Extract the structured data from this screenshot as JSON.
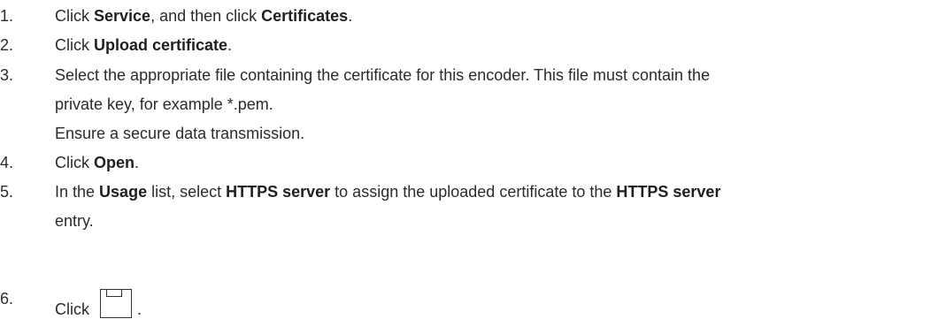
{
  "steps": [
    {
      "number": "1.",
      "lines": [
        [
          {
            "t": "Click ",
            "b": false
          },
          {
            "t": "Service",
            "b": true
          },
          {
            "t": ", and then click ",
            "b": false
          },
          {
            "t": "Certificates",
            "b": true
          },
          {
            "t": ".",
            "b": false
          }
        ]
      ]
    },
    {
      "number": "2.",
      "lines": [
        [
          {
            "t": "Click ",
            "b": false
          },
          {
            "t": "Upload certificate",
            "b": true
          },
          {
            "t": ".",
            "b": false
          }
        ]
      ]
    },
    {
      "number": "3.",
      "lines": [
        [
          {
            "t": "Select the appropriate file containing the certificate for this encoder. This file must contain the",
            "b": false
          }
        ],
        [
          {
            "t": "private key, for example *.pem.",
            "b": false
          }
        ],
        [
          {
            "t": "Ensure a secure data transmission.",
            "b": false
          }
        ]
      ]
    },
    {
      "number": "4.",
      "lines": [
        [
          {
            "t": "Click ",
            "b": false
          },
          {
            "t": "Open",
            "b": true
          },
          {
            "t": ".",
            "b": false
          }
        ]
      ]
    },
    {
      "number": "5.",
      "lines": [
        [
          {
            "t": "In the ",
            "b": false
          },
          {
            "t": "Usage",
            "b": true
          },
          {
            "t": " list, select ",
            "b": false
          },
          {
            "t": "HTTPS server",
            "b": true
          },
          {
            "t": " to assign the uploaded certificate to the ",
            "b": false
          },
          {
            "t": "HTTPS server",
            "b": true
          }
        ],
        [
          {
            "t": "entry.",
            "b": false
          }
        ]
      ]
    },
    {
      "number": "6.",
      "lines": [
        [
          {
            "t": "Click",
            "b": false
          },
          {
            "icon": "save-icon"
          },
          {
            "t": ".",
            "b": false
          }
        ]
      ]
    }
  ]
}
